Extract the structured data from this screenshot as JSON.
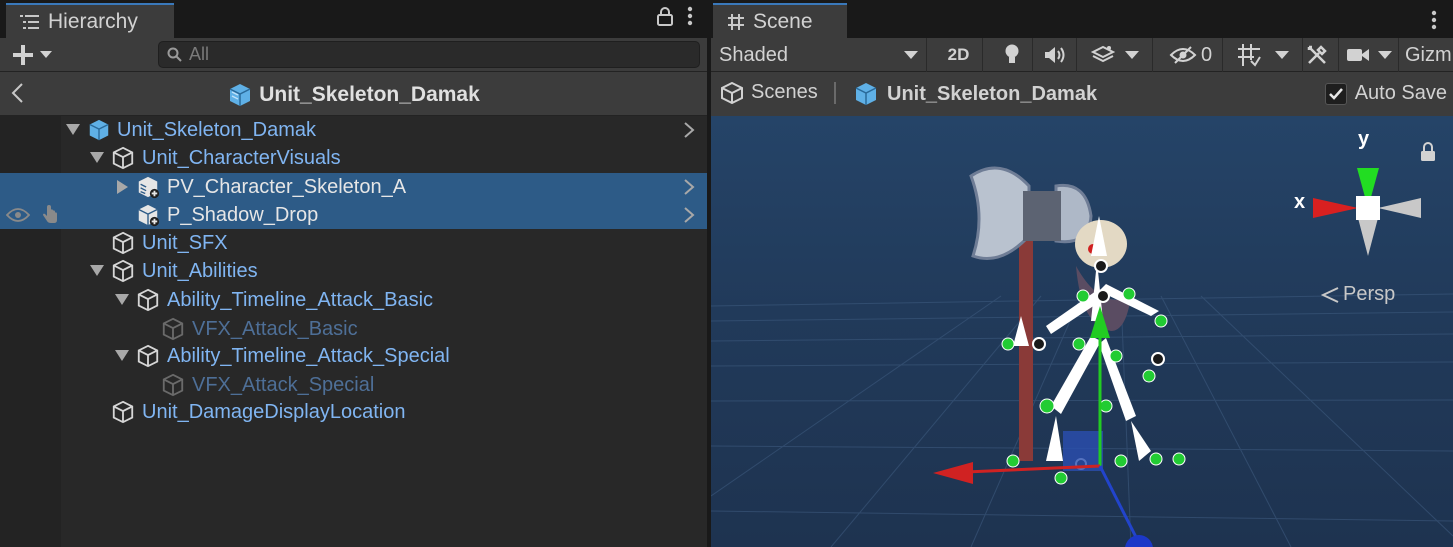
{
  "hierarchy": {
    "tab_label": "Hierarchy",
    "search_placeholder": "All",
    "breadcrumb_title": "Unit_Skeleton_Damak",
    "items": [
      {
        "label": "Unit_Skeleton_Damak",
        "style": "blue",
        "expanded": true,
        "icon": "prefab-cube-filled-icon"
      },
      {
        "label": "Unit_CharacterVisuals",
        "style": "blue",
        "expanded": true,
        "icon": "gameobject-cube-icon"
      },
      {
        "label": "PV_Character_Skeleton_A",
        "style": "white",
        "expanded": false,
        "icon": "prefab-variant-added-icon",
        "selected": true
      },
      {
        "label": "P_Shadow_Drop",
        "style": "white",
        "icon": "prefab-added-icon",
        "selected": true
      },
      {
        "label": "Unit_SFX",
        "style": "blue",
        "icon": "gameobject-cube-icon"
      },
      {
        "label": "Unit_Abilities",
        "style": "blue",
        "expanded": true,
        "icon": "gameobject-cube-icon"
      },
      {
        "label": "Ability_Timeline_Attack_Basic",
        "style": "blue",
        "expanded": true,
        "icon": "gameobject-cube-icon"
      },
      {
        "label": "VFX_Attack_Basic",
        "style": "dim",
        "icon": "gameobject-cube-icon"
      },
      {
        "label": "Ability_Timeline_Attack_Special",
        "style": "blue",
        "expanded": true,
        "icon": "gameobject-cube-icon"
      },
      {
        "label": "VFX_Attack_Special",
        "style": "dim",
        "icon": "gameobject-cube-icon"
      },
      {
        "label": "Unit_DamageDisplayLocation",
        "style": "blue",
        "icon": "gameobject-cube-icon"
      }
    ]
  },
  "scene": {
    "tab_label": "Scene",
    "shading_mode": "Shaded",
    "btn_2d": "2D",
    "hidden_count": "0",
    "gizmos_label": "Gizm",
    "breadcrumb_root": "Scenes",
    "breadcrumb_prefab": "Unit_Skeleton_Damak",
    "autosave_label": "Auto Save",
    "autosave_checked": true,
    "gizmo_axis_x": "x",
    "gizmo_axis_y": "y",
    "projection_label": "Persp"
  },
  "colors": {
    "accent": "#3a79bb",
    "selection": "#2d5b87",
    "label_blue": "#80b5f2",
    "viewport_bg": "#243c5c"
  }
}
